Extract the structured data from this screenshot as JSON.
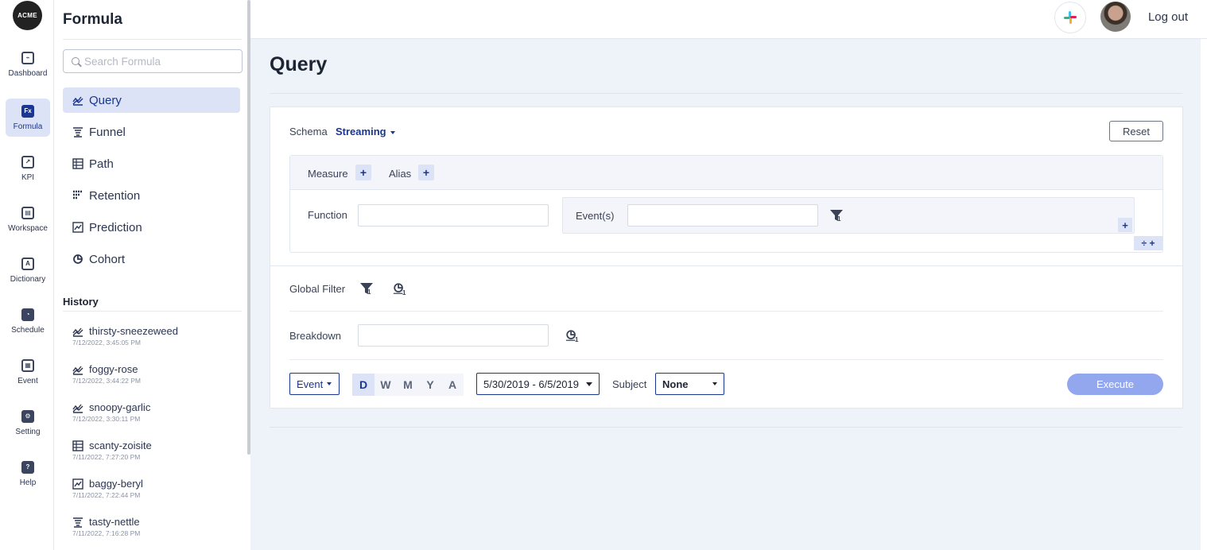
{
  "rail": {
    "logo": "ACME",
    "items": [
      {
        "label": "Dashboard",
        "icon": "dashboard-icon",
        "active": false
      },
      {
        "label": "Formula",
        "icon": "formula-icon",
        "active": true
      },
      {
        "label": "KPI",
        "icon": "kpi-icon",
        "active": false
      },
      {
        "label": "Workspace",
        "icon": "workspace-icon",
        "active": false
      },
      {
        "label": "Dictionary",
        "icon": "dictionary-icon",
        "active": false
      },
      {
        "label": "Schedule",
        "icon": "schedule-icon",
        "active": false
      },
      {
        "label": "Event",
        "icon": "event-icon",
        "active": false
      },
      {
        "label": "Setting",
        "icon": "setting-icon",
        "active": false
      },
      {
        "label": "Help",
        "icon": "help-icon",
        "active": false
      }
    ]
  },
  "panel": {
    "title": "Formula",
    "search_placeholder": "Search Formula",
    "nav": [
      {
        "label": "Query",
        "icon": "query-icon",
        "active": true
      },
      {
        "label": "Funnel",
        "icon": "funnel-icon",
        "active": false
      },
      {
        "label": "Path",
        "icon": "path-icon",
        "active": false
      },
      {
        "label": "Retention",
        "icon": "retention-icon",
        "active": false
      },
      {
        "label": "Prediction",
        "icon": "prediction-icon",
        "active": false
      },
      {
        "label": "Cohort",
        "icon": "cohort-icon",
        "active": false
      }
    ],
    "history_title": "History",
    "history": [
      {
        "name": "thirsty-sneezeweed",
        "time": "7/12/2022, 3:45:05 PM",
        "icon": "query-icon"
      },
      {
        "name": "foggy-rose",
        "time": "7/12/2022, 3:44:22 PM",
        "icon": "query-icon"
      },
      {
        "name": "snoopy-garlic",
        "time": "7/12/2022, 3:30:11 PM",
        "icon": "query-icon"
      },
      {
        "name": "scanty-zoisite",
        "time": "7/11/2022, 7:27:20 PM",
        "icon": "path-icon"
      },
      {
        "name": "baggy-beryl",
        "time": "7/11/2022, 7:22:44 PM",
        "icon": "prediction-icon"
      },
      {
        "name": "tasty-nettle",
        "time": "7/11/2022, 7:16:28 PM",
        "icon": "funnel-icon"
      }
    ]
  },
  "topbar": {
    "logout": "Log out"
  },
  "main": {
    "title": "Query",
    "schema_label": "Schema",
    "schema_value": "Streaming",
    "reset_label": "Reset",
    "measure_label": "Measure",
    "alias_label": "Alias",
    "function_label": "Function",
    "function_value": "",
    "events_label": "Event(s)",
    "events_value": "",
    "filter_count": "1",
    "global_filter_label": "Global Filter",
    "global_filter_count": "1",
    "global_cohort_count": "1",
    "breakdown_label": "Breakdown",
    "breakdown_value": "",
    "breakdown_cohort_count": "1",
    "event_select": "Event",
    "periods": [
      "D",
      "W",
      "M",
      "Y",
      "A"
    ],
    "active_period": "D",
    "date_range": "5/30/2019 - 6/5/2019",
    "subject_label": "Subject",
    "subject_value": "None",
    "execute_label": "Execute",
    "colors": {
      "accent": "#1a3592",
      "active_bg": "#dce3f6",
      "execute": "#93a7ef"
    }
  }
}
